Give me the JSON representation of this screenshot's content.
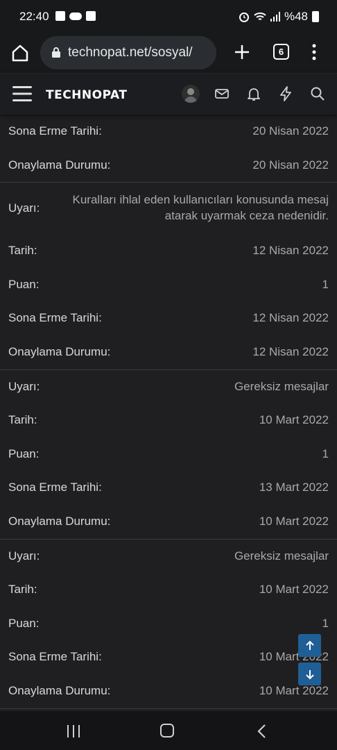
{
  "status_bar": {
    "time": "22:40",
    "battery": "%48",
    "icons": [
      "gallery-icon",
      "cloud-icon",
      "app-icon",
      "alarm-icon",
      "wifi-icon",
      "signal-icon",
      "battery-icon"
    ]
  },
  "browser": {
    "url": "technopat.net/sosyal/",
    "tab_count": "6"
  },
  "site_header": {
    "logo": "TECHNOPAT"
  },
  "warnings": [
    {
      "rows": [
        {
          "label": "Sona Erme Tarihi:",
          "value": "20 Nisan 2022"
        },
        {
          "label": "Onaylama Durumu:",
          "value": "20 Nisan 2022"
        }
      ]
    },
    {
      "rows": [
        {
          "label": "Uyarı:",
          "value": "Kuralları ihlal eden kullanıcıları konusunda mesaj atarak uyarmak ceza nedenidir."
        },
        {
          "label": "Tarih:",
          "value": "12 Nisan 2022"
        },
        {
          "label": "Puan:",
          "value": "1"
        },
        {
          "label": "Sona Erme Tarihi:",
          "value": "12 Nisan 2022"
        },
        {
          "label": "Onaylama Durumu:",
          "value": "12 Nisan 2022"
        }
      ]
    },
    {
      "rows": [
        {
          "label": "Uyarı:",
          "value": "Gereksiz mesajlar"
        },
        {
          "label": "Tarih:",
          "value": "10 Mart 2022"
        },
        {
          "label": "Puan:",
          "value": "1"
        },
        {
          "label": "Sona Erme Tarihi:",
          "value": "13 Mart 2022"
        },
        {
          "label": "Onaylama Durumu:",
          "value": "10 Mart 2022"
        }
      ]
    },
    {
      "rows": [
        {
          "label": "Uyarı:",
          "value": "Gereksiz mesajlar"
        },
        {
          "label": "Tarih:",
          "value": "10 Mart 2022"
        },
        {
          "label": "Puan:",
          "value": "1"
        },
        {
          "label": "Sona Erme Tarihi:",
          "value": "10 Mart 2022"
        },
        {
          "label": "Onaylama Durumu:",
          "value": "10 Mart 2022"
        }
      ]
    }
  ],
  "colors": {
    "background": "#1f1f21",
    "header": "#1c1d20",
    "scroll_button": "#1f5f96"
  }
}
